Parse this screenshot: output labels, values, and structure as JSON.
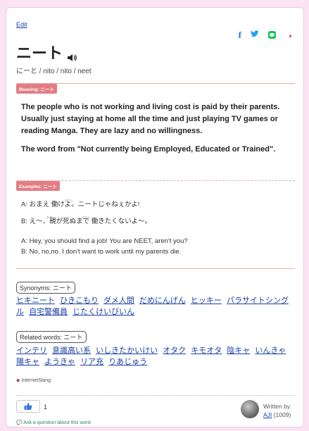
{
  "header": {
    "edit_label": "Edit",
    "title": "ニート",
    "reading": "にーと / nito / nito / neet"
  },
  "share": {
    "icons": [
      "facebook-icon",
      "twitter-icon",
      "line-icon",
      "more-icon"
    ]
  },
  "meaning": {
    "label": "Meaning: ニート",
    "paragraph1": "The people who is not working and living cost is paid by their parents. Usually just staying at home all the time and just playing TV games or reading Manga. They are lazy and no willingness.",
    "paragraph2": "The word from \"Not currently being Employed, Educated or Trained\"."
  },
  "examples": {
    "label": "Examples: ニート",
    "jp1": "A: おまえ 働けよ。ニートじゃねぇかよ!",
    "jp2": "B: え〜、親が死ぬまで 働きたくないよ〜。",
    "en1": "A: Hey, you should find a job! You are NEET, aren't you?",
    "en2": "B: No, no,no. I don't want to work until my parents die.",
    "ruby_hataraku": "はたら",
    "ruby_oya": "おや",
    "ruby_shi": "し"
  },
  "synonyms": {
    "label": "Synonyms: ニート",
    "items": [
      "ヒキニート",
      "ひきこもり",
      "ダメ人間",
      "だめにんげん",
      "ヒッキー",
      "パラサイトシングル",
      "自宅警備員",
      "じたくけいびいん"
    ]
  },
  "related": {
    "label": "Related words: ニート",
    "items": [
      "インテリ",
      "意識高い系",
      "いしきたかいけい",
      "オタク",
      "キモオタ",
      "陰キャ",
      "いんきゃ",
      "陽キャ",
      "ようきゃ",
      "リア充",
      "りあじゅう"
    ]
  },
  "hashtag": "InternetSlang",
  "footer": {
    "like_count": "1",
    "ask_label": "Ask a question about this word",
    "written_by": "Written by",
    "author": "AJI",
    "author_count": "(1009)"
  },
  "colors": {
    "accent": "#e27d84",
    "link": "#1a3fa8",
    "background": "#fbe3f2"
  }
}
